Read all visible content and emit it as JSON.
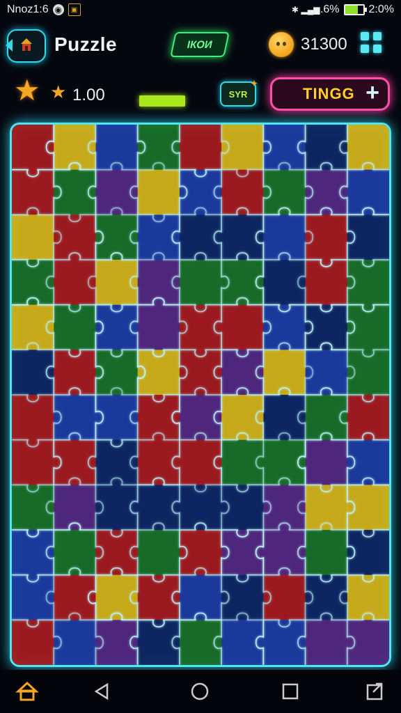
{
  "status_bar": {
    "carrier": "Nnoz1:6",
    "right_text": ".6%",
    "time": "2:0%"
  },
  "header": {
    "title": "Puzzle",
    "tag_label": "ІКОИ",
    "coin_count": "31300"
  },
  "stats": {
    "stars_count": "1.00",
    "progress_fraction": 1.0,
    "badge_label": "SYR",
    "action_label": "TINGG",
    "action_plus": "+"
  },
  "board": {
    "rows": 12,
    "cols": 9,
    "palette": [
      "#1f3fae",
      "#1a7a26",
      "#b51c1c",
      "#e8c416",
      "#5a2a8a",
      "#0e2a6a"
    ],
    "glow_color": "#bff6ff",
    "frame_color": "#4fe6f2"
  },
  "nav": {
    "items": [
      "home-icon",
      "back-triangle-icon",
      "home-circle-icon",
      "recents-square-icon",
      "share-icon"
    ]
  },
  "colors": {
    "accent_cyan": "#35d8e8",
    "accent_green": "#3ff07a",
    "accent_pink": "#ff4fa8",
    "gold": "#f5a623"
  }
}
